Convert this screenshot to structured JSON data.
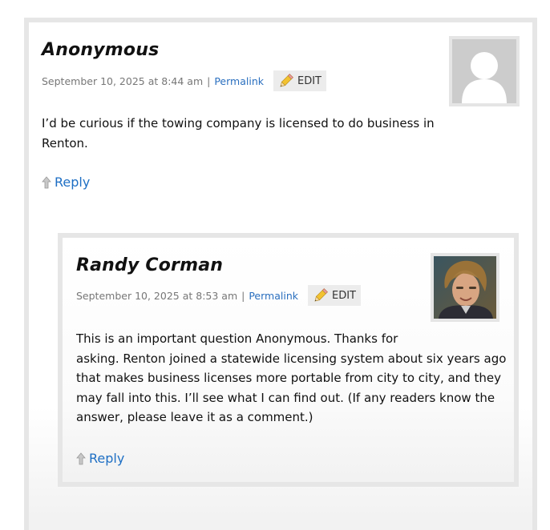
{
  "comments": [
    {
      "author": "Anonymous",
      "date": "September 10, 2025 at 8:44 am",
      "separator": "|",
      "permalink_label": "Permalink",
      "edit_label": "EDIT",
      "body": [
        "I’d be curious if the towing company is licensed to do business in",
        "Renton."
      ],
      "reply_label": "Reply",
      "avatar": "default-avatar"
    },
    {
      "author": "Randy Corman",
      "date": "September 10, 2025 at 8:53 am",
      "separator": "|",
      "permalink_label": "Permalink",
      "edit_label": "EDIT",
      "body": [
        "This is an important question Anonymous. Thanks for",
        "asking. Renton joined a statewide licensing system about six years ago",
        "that makes business licenses more portable from city to city, and they",
        "may fall into this. I’ll see what I can find out. (If any readers know the",
        "answer, please leave it as a comment.)"
      ],
      "reply_label": "Reply",
      "avatar": "user-photo-avatar"
    }
  ],
  "colors": {
    "link": "#2a6fbf",
    "reply": "#1e6fc4",
    "border": "#e6e6e6",
    "meta_text": "#777777"
  }
}
